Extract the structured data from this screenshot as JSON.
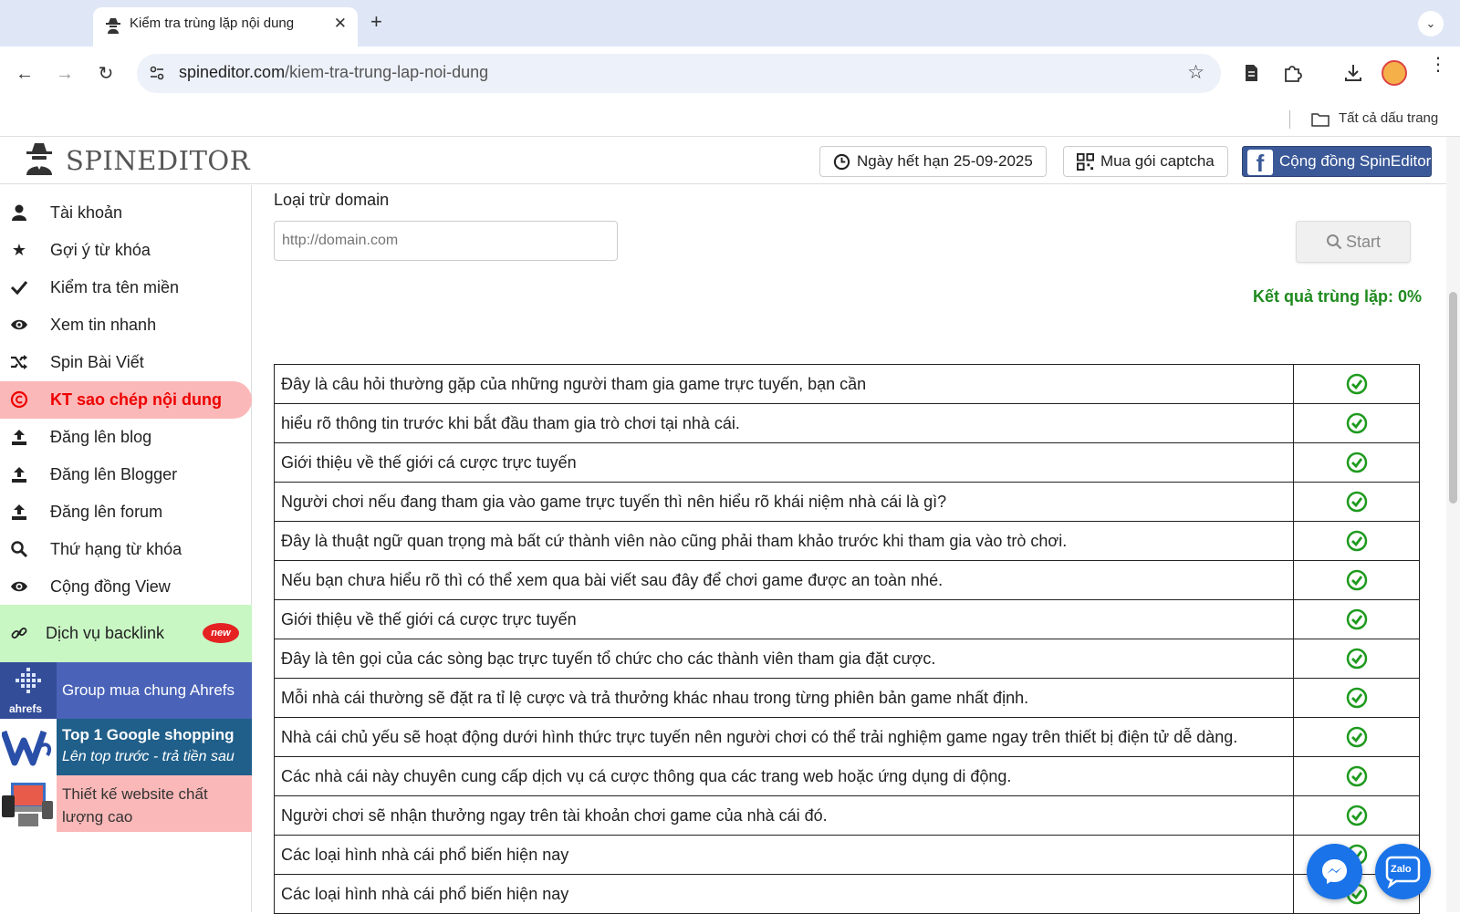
{
  "browser": {
    "tab_title": "Kiểm tra trùng lặp nội dung",
    "url_domain": "spineditor.com",
    "url_path": "/kiem-tra-trung-lap-noi-dung",
    "bookmarks_label": "Tất cả dấu trang"
  },
  "header": {
    "logo_text": "SPINEDITOR",
    "expiry_label": "Ngày hết hạn 25-09-2025",
    "captcha_label": "Mua gói captcha",
    "community_label": "Cộng đồng SpinEditor"
  },
  "sidebar": {
    "items": [
      {
        "label": "Tài khoản",
        "icon": "user-icon"
      },
      {
        "label": "Gợi ý từ khóa",
        "icon": "star-icon"
      },
      {
        "label": "Kiểm tra tên miền",
        "icon": "check-icon"
      },
      {
        "label": "Xem tin nhanh",
        "icon": "eye-icon"
      },
      {
        "label": "Spin Bài Viết",
        "icon": "shuffle-icon"
      },
      {
        "label": "KT sao chép nội dung",
        "icon": "copyright-icon"
      },
      {
        "label": "Đăng lên blog",
        "icon": "upload-icon"
      },
      {
        "label": "Đăng lên Blogger",
        "icon": "upload-icon"
      },
      {
        "label": "Đăng lên forum",
        "icon": "upload-icon"
      },
      {
        "label": "Thứ hạng từ khóa",
        "icon": "search-icon"
      },
      {
        "label": "Cộng đồng View",
        "icon": "eye-icon"
      }
    ],
    "backlink_label": "Dịch vụ backlink",
    "new_badge": "new",
    "promos": {
      "ahrefs_label": "Group mua chung Ahrefs",
      "ahrefs_logo_text": "ahrefs",
      "google_title": "Top 1 Google shopping",
      "google_sub": "Lên top trước - trả tiền sau",
      "website_label": "Thiết kế website chất lượng cao"
    }
  },
  "main": {
    "exclude_label": "Loại trừ domain",
    "domain_placeholder": "http://domain.com",
    "start_label": "Start",
    "result_text": "Kết quả trùng lặp: 0%",
    "rows": [
      "Đây là câu hỏi thường gặp của những người tham gia game trực tuyến, bạn cần",
      "hiểu rõ thông tin trước khi bắt đầu tham gia trò chơi tại nhà cái.",
      "Giới thiệu về thế giới cá cược trực tuyến",
      "Người chơi nếu đang tham gia vào game trực tuyến thì nên hiểu rõ khái niệm nhà cái là gì?",
      "Đây là thuật ngữ quan trọng mà bất cứ thành viên nào cũng phải tham khảo trước khi tham gia vào trò chơi.",
      "Nếu bạn chưa hiểu rõ thì có thể xem qua bài viết sau đây để chơi game được an toàn nhé.",
      "Giới thiệu về thế giới cá cược trực tuyến",
      "Đây là tên gọi của các sòng bạc trực tuyến tổ chức cho các thành viên tham gia đặt cược.",
      "Mỗi nhà cái thường sẽ đặt ra tỉ lệ cược và trả thưởng khác nhau trong từng phiên bản game nhất định.",
      "Nhà cái chủ yếu sẽ hoạt động dưới hình thức trực tuyến nên người chơi có thể trải nghiệm game ngay trên thiết bị điện tử dễ dàng.",
      "Các nhà cái này chuyên cung cấp dịch vụ cá cược thông qua các trang web hoặc ứng dụng di động.",
      "Người chơi sẽ nhận thưởng ngay trên tài khoản chơi game của nhà cái đó.",
      "Các loại hình nhà cái phổ biến hiện nay",
      "Các loại hình nhà cái phổ biến hiện nay"
    ]
  },
  "floating": {
    "zalo_label": "Zalo"
  },
  "colors": {
    "active_bg": "#fbb8b8",
    "active_text": "#e00000",
    "result_green": "#1e8a1e",
    "facebook_blue": "#3b5998",
    "ahrefs_bg": "#4a63b8",
    "google_bg": "#1f5f8a",
    "website_bg": "#fbb8b8",
    "backlink_bg": "#c8f7c4"
  }
}
